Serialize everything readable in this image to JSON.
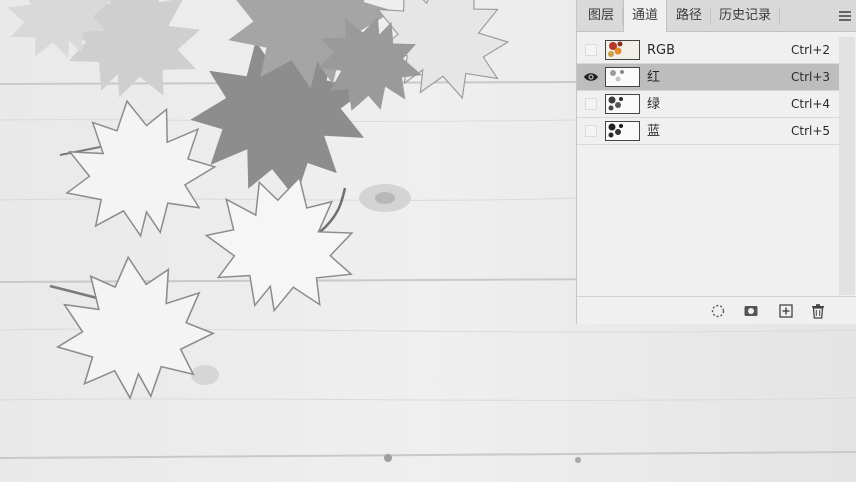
{
  "panel": {
    "tabs": [
      {
        "label": "图层",
        "active": false
      },
      {
        "label": "通道",
        "active": true
      },
      {
        "label": "路径",
        "active": false
      },
      {
        "label": "历史记录",
        "active": false
      }
    ],
    "menu_icon": "panel-menu-icon"
  },
  "channels": [
    {
      "name": "RGB",
      "shortcut": "Ctrl+2",
      "visible": false,
      "selected": false
    },
    {
      "name": "红",
      "shortcut": "Ctrl+3",
      "visible": true,
      "selected": true
    },
    {
      "name": "绿",
      "shortcut": "Ctrl+4",
      "visible": false,
      "selected": false
    },
    {
      "name": "蓝",
      "shortcut": "Ctrl+5",
      "visible": false,
      "selected": false
    }
  ],
  "footer": {
    "buttons": [
      "load-selection-icon",
      "save-selection-as-channel-icon",
      "new-channel-icon",
      "delete-channel-icon"
    ]
  },
  "colors": {
    "panel_bg": "#f0f0f0",
    "tab_bar_bg": "#d9d9d9",
    "selected_row_bg": "#bdbdbd"
  }
}
